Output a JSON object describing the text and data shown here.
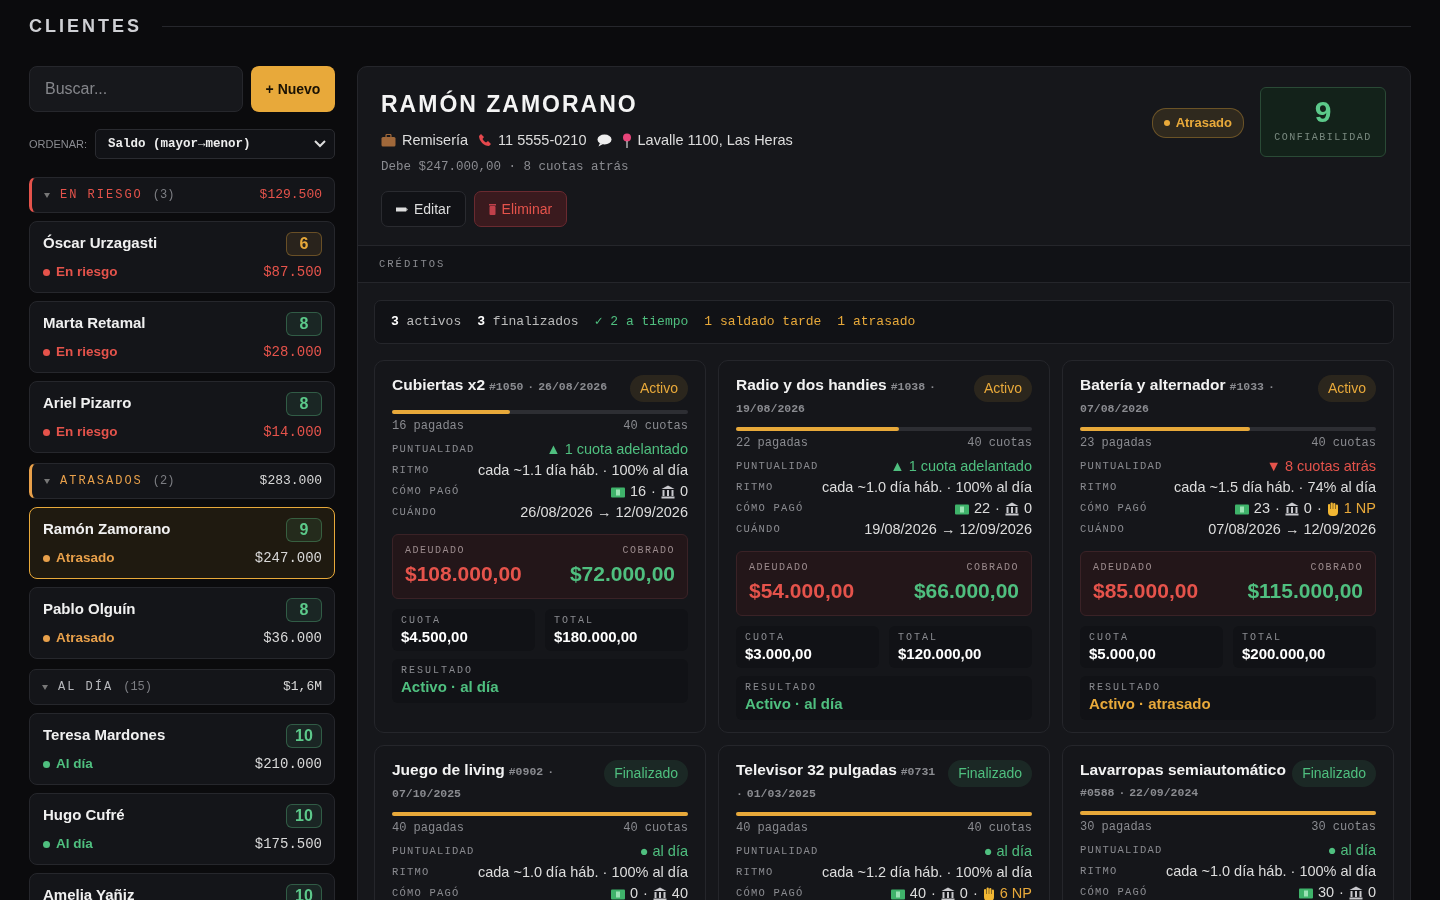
{
  "page": {
    "title": "CLIENTES"
  },
  "sidebar": {
    "search": {
      "placeholder": "Buscar..."
    },
    "new_button": "+ Nuevo",
    "sort": {
      "label": "ORDENAR:",
      "value": "Saldo (mayor→menor)"
    },
    "groups": [
      {
        "label": "EN RIESGO",
        "count": "(3)",
        "total": "$129.500",
        "color": "#e5534b",
        "flagged": true,
        "critical": true,
        "expanded": true,
        "clients": [
          {
            "name": "Óscar Urzagasti",
            "score": "6",
            "color": "#e8a93a",
            "status": "En riesgo",
            "balance": "$87.500",
            "selected": false
          },
          {
            "name": "Marta Retamal",
            "score": "8",
            "color": "#5cc98a",
            "status": "En riesgo",
            "balance": "$28.000",
            "selected": false
          },
          {
            "name": "Ariel Pizarro",
            "score": "8",
            "color": "#5cc98a",
            "status": "En riesgo",
            "balance": "$14.000",
            "selected": false
          }
        ]
      },
      {
        "label": "ATRASADOS",
        "count": "(2)",
        "total": "$283.000",
        "color": "#e8a04a",
        "flagged": true,
        "critical": false,
        "expanded": true,
        "clients": [
          {
            "name": "Ramón Zamorano",
            "score": "9",
            "color": "#5cc98a",
            "status": "Atrasado",
            "balance": "$247.000",
            "selected": true
          },
          {
            "name": "Pablo Olguín",
            "score": "8",
            "color": "#5cc98a",
            "status": "Atrasado",
            "balance": "$36.000",
            "selected": false
          }
        ]
      },
      {
        "label": "AL DÍA",
        "count": "(15)",
        "total": "$1,6M",
        "color": "#4fbf7f",
        "flagged": false,
        "critical": false,
        "expanded": true,
        "clients": [
          {
            "name": "Teresa Mardones",
            "score": "10",
            "color": "#5cc98a",
            "status": "Al día",
            "balance": "$210.000",
            "selected": false
          },
          {
            "name": "Hugo Cufré",
            "score": "10",
            "color": "#5cc98a",
            "status": "Al día",
            "balance": "$175.500",
            "selected": false
          },
          {
            "name": "Amelia Yañiz",
            "score": "10",
            "color": "#5cc98a",
            "selected": false
          }
        ]
      }
    ]
  },
  "client": {
    "name": "RAMÓN ZAMORANO",
    "details": [
      {
        "kind": "briefcase",
        "text": "Remisería"
      },
      {
        "kind": "phone",
        "text": "11 5555-0210"
      },
      {
        "kind": "chat"
      },
      {
        "kind": "pin",
        "text": "Lavalle 1100, Las Heras"
      }
    ],
    "summary": "Debe $247.000,00 · 8 cuotas atrás",
    "buttons": [
      {
        "kind": "edit",
        "label": "Editar"
      },
      {
        "kind": "delete",
        "label": "Eliminar"
      }
    ],
    "status": {
      "label": "Atrasado",
      "color": "#e8a93a"
    },
    "score": {
      "value": "9",
      "label": "CONFIABILIDAD"
    }
  },
  "credits": {
    "title": "CRÉDITOS",
    "stats": [
      {
        "text": "**3** activos",
        "color": "#bbbbbb"
      },
      {
        "text": "**3** finalizados",
        "color": "#bbbbbb"
      },
      {
        "text": "✓ 2 a tiempo",
        "color": "#4fbf7f"
      },
      {
        "text": "1 saldado tarde",
        "color": "#e8a93a"
      },
      {
        "text": "1 atrasado",
        "color": "#e8a93a"
      }
    ],
    "items": [
      {
        "title": "Cubiertas x2",
        "code": "#1050",
        "sep": "·",
        "date": "26/08/2026",
        "status": "Activo",
        "color": "#e8a93a",
        "level": 0.4,
        "paid": "16 pagadas",
        "installments": "40 cuotas",
        "rows": [
          {
            "kind": "text",
            "label": "PUNTUALIDAD",
            "value": "▲ 1 cuota adelantado",
            "color": "#4fbf7f"
          },
          {
            "kind": "text",
            "label": "RITMO",
            "value": "cada ~1.1 día háb. · 100% al día",
            "color": "#dddddd"
          },
          {
            "kind": "payments",
            "label": "CÓMO PAGÓ",
            "cash": "16",
            "bank": "0"
          },
          {
            "kind": "text",
            "label": "CUÁNDO",
            "value": "26/08/2026 → 12/09/2026",
            "color": "#dddddd"
          }
        ],
        "owed": {
          "label": "ADEUDADO",
          "value": "$108.000,00"
        },
        "collected": {
          "label": "COBRADO",
          "value": "$72.000,00"
        },
        "installment": {
          "label": "CUOTA",
          "value": "$4.500,00"
        },
        "total": {
          "label": "TOTAL",
          "value": "$180.000,00"
        },
        "result": {
          "label": "RESULTADO",
          "value": "Activo · al día",
          "color": "#4fbf7f"
        }
      },
      {
        "title": "Radio y dos handies",
        "code": "#1038",
        "sep": "·",
        "date": "19/08/2026",
        "status": "Activo",
        "color": "#e8a93a",
        "level": 0.55,
        "paid": "22 pagadas",
        "installments": "40 cuotas",
        "rows": [
          {
            "kind": "text",
            "label": "PUNTUALIDAD",
            "value": "▲ 1 cuota adelantado",
            "color": "#4fbf7f"
          },
          {
            "kind": "text",
            "label": "RITMO",
            "value": "cada ~1.0 día háb. · 100% al día",
            "color": "#dddddd"
          },
          {
            "kind": "payments",
            "label": "CÓMO PAGÓ",
            "cash": "22",
            "bank": "0"
          },
          {
            "kind": "text",
            "label": "CUÁNDO",
            "value": "19/08/2026 → 12/09/2026",
            "color": "#dddddd"
          }
        ],
        "owed": {
          "label": "ADEUDADO",
          "value": "$54.000,00"
        },
        "collected": {
          "label": "COBRADO",
          "value": "$66.000,00"
        },
        "installment": {
          "label": "CUOTA",
          "value": "$3.000,00"
        },
        "total": {
          "label": "TOTAL",
          "value": "$120.000,00"
        },
        "result": {
          "label": "RESULTADO",
          "value": "Activo · al día",
          "color": "#4fbf7f"
        }
      },
      {
        "title": "Batería y alternador",
        "code": "#1033",
        "sep": "·",
        "date": "07/08/2026",
        "status": "Activo",
        "color": "#e8a93a",
        "level": 0.575,
        "paid": "23 pagadas",
        "installments": "40 cuotas",
        "rows": [
          {
            "kind": "text",
            "label": "PUNTUALIDAD",
            "value": "▼ 8 cuotas atrás",
            "color": "#e5534b"
          },
          {
            "kind": "text",
            "label": "RITMO",
            "value": "cada ~1.5 día háb. · 74% al día",
            "color": "#dddddd"
          },
          {
            "kind": "payments",
            "label": "CÓMO PAGÓ",
            "cash": "23",
            "bank": "0",
            "np": "1 NP"
          },
          {
            "kind": "text",
            "label": "CUÁNDO",
            "value": "07/08/2026 → 12/09/2026",
            "color": "#dddddd"
          }
        ],
        "owed": {
          "label": "ADEUDADO",
          "value": "$85.000,00"
        },
        "collected": {
          "label": "COBRADO",
          "value": "$115.000,00"
        },
        "installment": {
          "label": "CUOTA",
          "value": "$5.000,00"
        },
        "total": {
          "label": "TOTAL",
          "value": "$200.000,00"
        },
        "result": {
          "label": "RESULTADO",
          "value": "Activo · atrasado",
          "color": "#e8a93a"
        }
      },
      {
        "title": "Juego de living",
        "code": "#0902",
        "sep": "·",
        "date": "07/10/2025",
        "status": "Finalizado",
        "color": "#4fbf7f",
        "level": 1,
        "paid": "40 pagadas",
        "installments": "40 cuotas",
        "rows": [
          {
            "kind": "text",
            "label": "PUNTUALIDAD",
            "value": "● al día",
            "color": "#4fbf7f"
          },
          {
            "kind": "text",
            "label": "RITMO",
            "value": "cada ~1.0 día háb. · 100% al día",
            "color": "#dddddd"
          },
          {
            "kind": "payments",
            "label": "CÓMO PAGÓ",
            "cash": "0",
            "bank": "40"
          }
        ]
      },
      {
        "title": "Televisor 32 pulgadas",
        "code": "#0731",
        "sep": "·",
        "date": "01/03/2025",
        "status": "Finalizado",
        "color": "#4fbf7f",
        "level": 1,
        "paid": "40 pagadas",
        "installments": "40 cuotas",
        "rows": [
          {
            "kind": "text",
            "label": "PUNTUALIDAD",
            "value": "● al día",
            "color": "#4fbf7f"
          },
          {
            "kind": "text",
            "label": "RITMO",
            "value": "cada ~1.2 día háb. · 100% al día",
            "color": "#dddddd"
          },
          {
            "kind": "payments",
            "label": "CÓMO PAGÓ",
            "cash": "40",
            "bank": "0",
            "np": "6 NP"
          }
        ]
      },
      {
        "title": "Lavarropas semiautomático",
        "code": "#0588",
        "sep": "·",
        "date": "22/09/2024",
        "status": "Finalizado",
        "color": "#4fbf7f",
        "level": 1,
        "paid": "30 pagadas",
        "installments": "30 cuotas",
        "rows": [
          {
            "kind": "text",
            "label": "PUNTUALIDAD",
            "value": "● al día",
            "color": "#4fbf7f"
          },
          {
            "kind": "text",
            "label": "RITMO",
            "value": "cada ~1.0 día háb. · 100% al día",
            "color": "#dddddd"
          },
          {
            "kind": "payments",
            "label": "CÓMO PAGÓ",
            "cash": "30",
            "bank": "0"
          }
        ]
      }
    ]
  }
}
